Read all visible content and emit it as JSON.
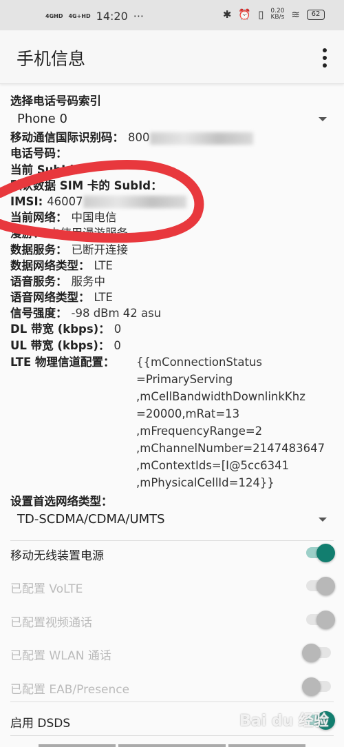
{
  "status_bar": {
    "signal1": "4GHD",
    "signal2": "4G+HD",
    "time": "14:20",
    "more": "···",
    "speed": "0.20",
    "speed_unit": "KB/s",
    "battery": "62"
  },
  "app_bar": {
    "title": "手机信息",
    "menu_icon": "more-vert-icon"
  },
  "phone_index": {
    "label": "选择电话号码索引",
    "selected": "Phone 0"
  },
  "info": [
    {
      "key": "移动通信国际识别码：",
      "value": "800"
    },
    {
      "key": "电话号码：",
      "value": ""
    },
    {
      "key": "当前 SubId：",
      "value": ""
    },
    {
      "key": "默认数据 SIM 卡的 SubId：",
      "value": ""
    },
    {
      "key": "IMSI:",
      "value": "46007"
    },
    {
      "key": "当前网络：",
      "value": "中国电信"
    },
    {
      "key": "漫游：",
      "value": "未使用漫游服务"
    },
    {
      "key": "数据服务：",
      "value": "已断开连接"
    },
    {
      "key": "数据网络类型：",
      "value": "LTE"
    },
    {
      "key": "语音服务：",
      "value": "服务中"
    },
    {
      "key": "语音网络类型：",
      "value": "LTE"
    },
    {
      "key": "信号强度：",
      "value": "-98 dBm   42 asu"
    },
    {
      "key": "DL 带宽 (kbps)：",
      "value": "0"
    },
    {
      "key": "UL 带宽 (kbps)：",
      "value": "0"
    }
  ],
  "lte_config": {
    "key": "LTE 物理信道配置：",
    "lines": [
      "{{mConnectionStatus",
      "=PrimaryServing",
      ",mCellBandwidthDownlinkKhz",
      "=20000,mRat=13",
      ",mFrequencyRange=2",
      ",mChannelNumber=2147483647",
      ",mContextIds=[I@5cc6341",
      ",mPhysicalCellId=124}}"
    ]
  },
  "network_type": {
    "label": "设置首选网络类型：",
    "selected": "TD-SCDMA/CDMA/UMTS"
  },
  "toggles": [
    {
      "label": "移动无线装置电源",
      "on": true,
      "enabled": true
    },
    {
      "label": "已配置 VoLTE",
      "on": true,
      "enabled": false
    },
    {
      "label": "已配置视频通话",
      "on": true,
      "enabled": false
    },
    {
      "label": "已配置 WLAN 通话",
      "on": false,
      "enabled": false
    },
    {
      "label": "已配置 EAB/Presence",
      "on": false,
      "enabled": false
    },
    {
      "label": "启用 DSDS",
      "on": true,
      "enabled": true
    }
  ],
  "watermark": "Bai du 经验",
  "colors": {
    "accent": "#127e6f",
    "annotation": "#e8383d"
  }
}
